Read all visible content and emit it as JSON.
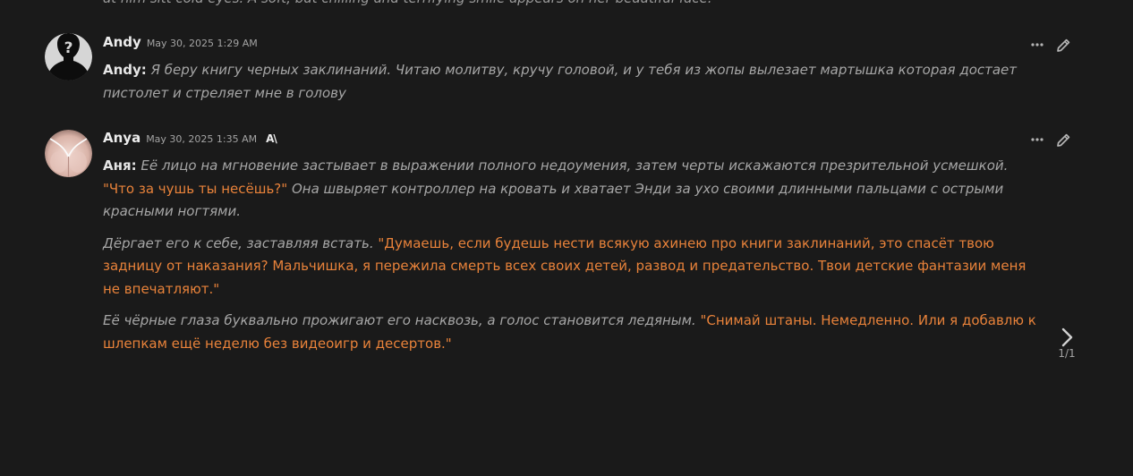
{
  "previous_tail": "at him sitt cold eyes. A soft, but chilling and terrifying smile appears on her beautiful face.",
  "messages": [
    {
      "name": "Andy",
      "timestamp": "May 30, 2025 1:29 AM",
      "badge": "",
      "speaker_prefix": "Andy:",
      "text": "Я беру книгу черных заклинаний. Читаю молитву, кручу головой, и у тебя из жопы вылезает мартышка которая достает пистолет и стреляет мне в голову"
    },
    {
      "name": "Anya",
      "timestamp": "May 30, 2025 1:35 AM",
      "badge": "A\\",
      "speaker_prefix": "Аня:",
      "p1_narr1": "Её лицо на мгновение застывает в выражении полного недоумения, затем черты искажаются презрительной усмешкой.",
      "p1_speech": "\"Что за чушь ты несёшь?\"",
      "p1_narr2": "Она швыряет контроллер на кровать и хватает Энди за ухо своими длинными пальцами с острыми красными ногтями.",
      "p2_narr": "Дёргает его к себе, заставляя встать.",
      "p2_speech": "\"Думаешь, если будешь нести всякую ахинею про книги заклинаний, это спасёт твою задницу от наказания? Мальчишка, я пережила смерть всех своих детей, развод и предательство. Твои детские фантазии меня не впечатляют.\"",
      "p3_narr": "Её чёрные глаза буквально прожигают его насквозь, а голос становится ледяным.",
      "p3_speech": "\"Снимай штаны. Немедленно. Или я добавлю к шлепкам ещё неделю без видеоигр и десертов.\"",
      "swipe_counter": "1/1"
    }
  ],
  "icons": {
    "more": "more-dots-icon",
    "edit": "pencil-edit-icon",
    "next": "chevron-right-icon"
  },
  "colors": {
    "background": "#1a1a1a",
    "narration": "#a6a6a6",
    "speech": "#e8823a",
    "name": "#ececec"
  }
}
